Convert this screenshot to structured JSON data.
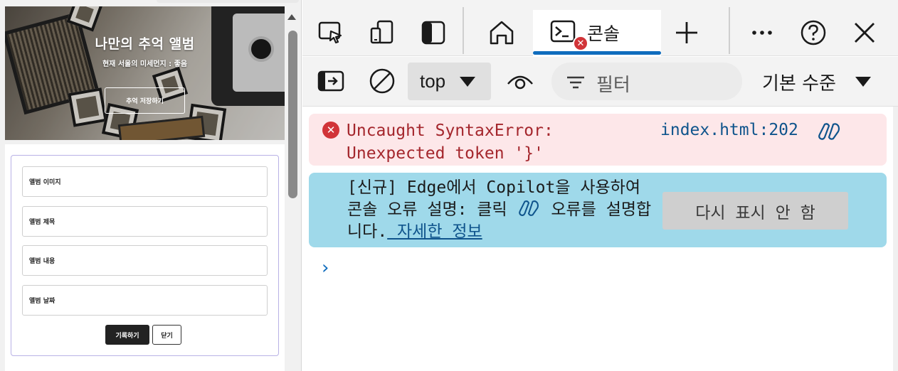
{
  "webpage": {
    "hero": {
      "title": "나만의 추억 앨범",
      "subtitle": "현재 서울의 미세먼지 : 좋음",
      "button_label": "추억 저장하기"
    },
    "form": {
      "fields": [
        {
          "placeholder": "앨범 이미지"
        },
        {
          "placeholder": "앨범 제목"
        },
        {
          "placeholder": "앨범 내용"
        },
        {
          "placeholder": "앨범 날짜"
        }
      ],
      "submit_label": "기록하기",
      "close_label": "닫기"
    }
  },
  "devtools": {
    "tabs": {
      "inspect_icon": "inspect-element-icon",
      "device_icon": "device-emulation-icon",
      "sidebar_icon": "toggle-sidebar-icon",
      "home_icon": "home-icon",
      "console_label": "콘솔",
      "console_error_badge": "✕",
      "add_icon": "plus-icon",
      "more_icon": "more-icon",
      "help_icon": "help-icon",
      "close_icon": "close-icon"
    },
    "toolbar": {
      "context": "top",
      "filter_placeholder": "필터",
      "level": "기본 수준"
    },
    "messages": {
      "error_text": "Uncaught SyntaxError: Unexpected token '}'",
      "error_source": "index.html:202",
      "info_prefix": "[신규] Edge에서 Copilot을 사용하여 콘솔 오류 설명: 클릭",
      "info_suffix": "오류를 설명합니다.",
      "info_link": " 자세한 정보",
      "dismiss_label": "다시 표시 안 함"
    },
    "prompt_symbol": "›"
  },
  "colors": {
    "accent": "#0f6cbd",
    "error_bg": "#fde7e9",
    "error_text": "#a4262c",
    "info_bg": "#9fd9ea"
  }
}
